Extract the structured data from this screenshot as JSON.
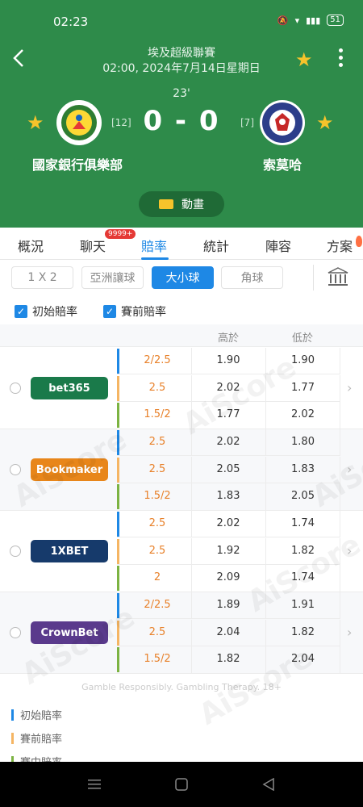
{
  "status": {
    "time": "02:23",
    "battery": "51"
  },
  "match": {
    "league": "埃及超級聯賽",
    "datetime": "02:00, 2024年7月14日星期日",
    "minute": "23'",
    "score": "0 - 0",
    "home": {
      "name": "國家銀行俱樂部",
      "rank": "[12]"
    },
    "away": {
      "name": "索莫哈",
      "rank": "[7]"
    },
    "animation_label": "動畫"
  },
  "tabs": [
    {
      "label": "概況"
    },
    {
      "label": "聊天"
    },
    {
      "label": "賠率"
    },
    {
      "label": "統計"
    },
    {
      "label": "陣容"
    },
    {
      "label": "方案"
    }
  ],
  "chat_badge": "9999+",
  "subtabs": [
    {
      "label": "1 X 2"
    },
    {
      "label": "亞洲讓球"
    },
    {
      "label": "大小球"
    },
    {
      "label": "角球"
    }
  ],
  "filters": {
    "initial": "初始賠率",
    "pre": "賽前賠率"
  },
  "columns": {
    "over": "高於",
    "under": "低於"
  },
  "bookmakers": [
    {
      "name": "bet365",
      "color": "#1a7a4a",
      "rows": [
        {
          "line": "2/2.5",
          "over": "1.90",
          "under": "1.90"
        },
        {
          "line": "2.5",
          "over": "2.02",
          "under": "1.77"
        },
        {
          "line": "1.5/2",
          "over": "1.77",
          "under": "2.02"
        }
      ]
    },
    {
      "name": "Bookmaker",
      "color": "#e8861a",
      "rows": [
        {
          "line": "2.5",
          "over": "2.02",
          "under": "1.80"
        },
        {
          "line": "2.5",
          "over": "2.05",
          "under": "1.83"
        },
        {
          "line": "1.5/2",
          "over": "1.83",
          "under": "2.05"
        }
      ]
    },
    {
      "name": "1XBET",
      "color": "#163a6b",
      "rows": [
        {
          "line": "2.5",
          "over": "2.02",
          "under": "1.74"
        },
        {
          "line": "2.5",
          "over": "1.92",
          "under": "1.82"
        },
        {
          "line": "2",
          "over": "2.09",
          "under": "1.74"
        }
      ]
    },
    {
      "name": "CrownBet",
      "color": "#5a3a8c",
      "rows": [
        {
          "line": "2/2.5",
          "over": "1.89",
          "under": "1.91"
        },
        {
          "line": "2.5",
          "over": "2.04",
          "under": "1.82"
        },
        {
          "line": "1.5/2",
          "over": "1.82",
          "under": "2.04"
        }
      ]
    }
  ],
  "disclaimer": "Gamble Responsibly. Gambling Therapy. 18+",
  "legend": [
    {
      "label": "初始賠率",
      "color": "#1e88e5"
    },
    {
      "label": "賽前賠率",
      "color": "#f5b563"
    },
    {
      "label": "賽中賠率",
      "color": "#7cb342"
    }
  ],
  "colors": {
    "header": "#2e8b4a",
    "accent": "#1e88e5",
    "star": "#f6c32b",
    "odds_line": "#e8812a"
  }
}
